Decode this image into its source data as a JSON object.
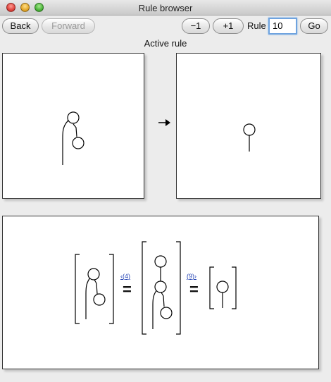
{
  "window": {
    "title": "Rule browser"
  },
  "toolbar": {
    "back_label": "Back",
    "forward_label": "Forward",
    "minus_label": "−1",
    "plus_label": "+1",
    "rule_label": "Rule",
    "rule_value": "10",
    "go_label": "Go"
  },
  "section_title": "Active rule",
  "derivation": {
    "link_left": "‹(4)",
    "link_right": "(9)›",
    "equals": "="
  }
}
